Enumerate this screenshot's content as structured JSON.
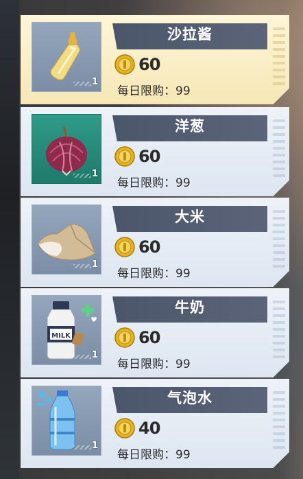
{
  "shop": {
    "items": [
      {
        "name": "沙拉酱",
        "price": "60",
        "limit_label": "每日限购：",
        "limit": "99",
        "qty_icon": "1",
        "icon": "mayonnaise-bottle-icon",
        "selected": true
      },
      {
        "name": "洋葱",
        "price": "60",
        "limit_label": "每日限购：",
        "limit": "99",
        "qty_icon": "1",
        "icon": "onion-icon"
      },
      {
        "name": "大米",
        "price": "60",
        "limit_label": "每日限购：",
        "limit": "99",
        "qty_icon": "1",
        "icon": "rice-sack-icon"
      },
      {
        "name": "牛奶",
        "price": "60",
        "limit_label": "每日限购：",
        "limit": "99",
        "qty_icon": "1",
        "icon": "milk-bottle-icon"
      },
      {
        "name": "气泡水",
        "price": "40",
        "limit_label": "每日限购：",
        "limit": "99",
        "qty_icon": "1",
        "icon": "water-bottle-icon"
      }
    ],
    "milk_label": "MILK"
  },
  "colors": {
    "selected_card": "#f6e7b6",
    "card": "#dde6f1",
    "name_bar": "#4c566a",
    "coin": "#e7b321"
  }
}
